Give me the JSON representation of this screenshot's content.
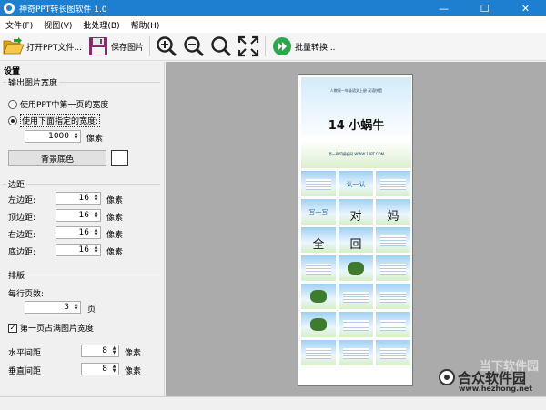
{
  "window": {
    "title": "神奇PPT转长图软件 1.0",
    "controls": {
      "minimize": "—",
      "maximize": "☐",
      "close": "✕"
    }
  },
  "menu": {
    "items": [
      {
        "label": "文件(F)"
      },
      {
        "label": "视图(V)"
      },
      {
        "label": "批处理(B)"
      },
      {
        "label": "帮助(H)"
      }
    ]
  },
  "toolbar": {
    "open_label": "打开PPT文件...",
    "save_label": "保存图片",
    "batch_label": "批量转换...",
    "icons": [
      "folder-open-icon",
      "floppy-save-icon",
      "zoom-in-icon",
      "zoom-out-icon",
      "zoom-reset-icon",
      "fit-window-icon",
      "batch-convert-icon"
    ]
  },
  "settings": {
    "header": "设置",
    "output_width": {
      "title": "输出图片宽度",
      "option_first_page": "使用PPT中第一页的宽度",
      "option_custom": "使用下面指定的宽度:",
      "selected": "option_custom",
      "width_value": "1000",
      "width_unit": "像素",
      "bg_button": "背景底色",
      "bg_color": "#ffffff"
    },
    "margins": {
      "title": "边距",
      "unit": "像素",
      "left_label": "左边距:",
      "left_value": "16",
      "top_label": "顶边距:",
      "top_value": "16",
      "right_label": "右边距:",
      "right_value": "16",
      "bottom_label": "底边距:",
      "bottom_value": "16"
    },
    "layout": {
      "title": "排版",
      "per_row_label": "每行页数:",
      "per_row_value": "3",
      "per_row_unit": "页",
      "first_page_full_label": "第一页占满图片宽度",
      "first_page_full_checked": true,
      "h_spacing_label": "水平间距",
      "h_spacing_value": "8",
      "v_spacing_label": "垂直间距",
      "v_spacing_value": "8",
      "unit": "像素"
    }
  },
  "preview": {
    "slide_header": "人教版一年级语文上册  汉语拼音",
    "slide_title": "14 小蜗牛",
    "slide_footer": "第一PPT模板网 WWW.1PPT.COM",
    "thumb_texts": [
      "认一认",
      "写一写",
      "对",
      "妈",
      "全",
      "回"
    ]
  },
  "watermark": {
    "top_text": "当下软件园",
    "name": "合众软件园",
    "url": "www.hezhong.net"
  },
  "colors": {
    "titlebar": "#1e7fd1",
    "preview_bg": "#ababab",
    "panel_bg": "#f0f0f0"
  }
}
